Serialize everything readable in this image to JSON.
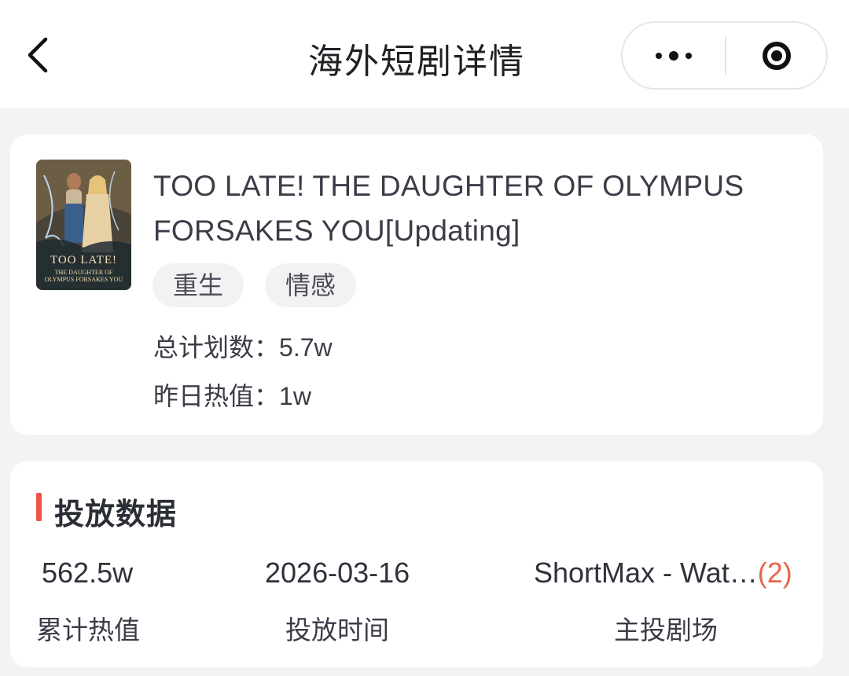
{
  "nav": {
    "title": "海外短剧详情",
    "back_icon": "chevron-left-icon",
    "more_icon": "more-dots-icon",
    "close_icon": "target-close-icon"
  },
  "drama": {
    "poster_text_line1": "TOO LATE!",
    "poster_text_line2": "THE DAUGHTER OF OLYMPUS FORSAKES YOU",
    "title": "TOO LATE! THE DAUGHTER OF OLYMPUS FORSAKES YOU[Updating]",
    "tags": [
      "重生",
      "情感"
    ],
    "total_plan_label": "总计划数：",
    "total_plan_value": "5.7w",
    "yesterday_heat_label": "昨日热值：",
    "yesterday_heat_value": "1w"
  },
  "placement": {
    "section_title": "投放数据",
    "accent_color": "#f0524a",
    "metrics": [
      {
        "value": "562.5w",
        "label": "累计热值"
      },
      {
        "value": "2026-03-16",
        "label": "投放时间"
      },
      {
        "value": "ShortMax - Wat…",
        "count": "(2)",
        "label": "主投剧场"
      }
    ]
  }
}
